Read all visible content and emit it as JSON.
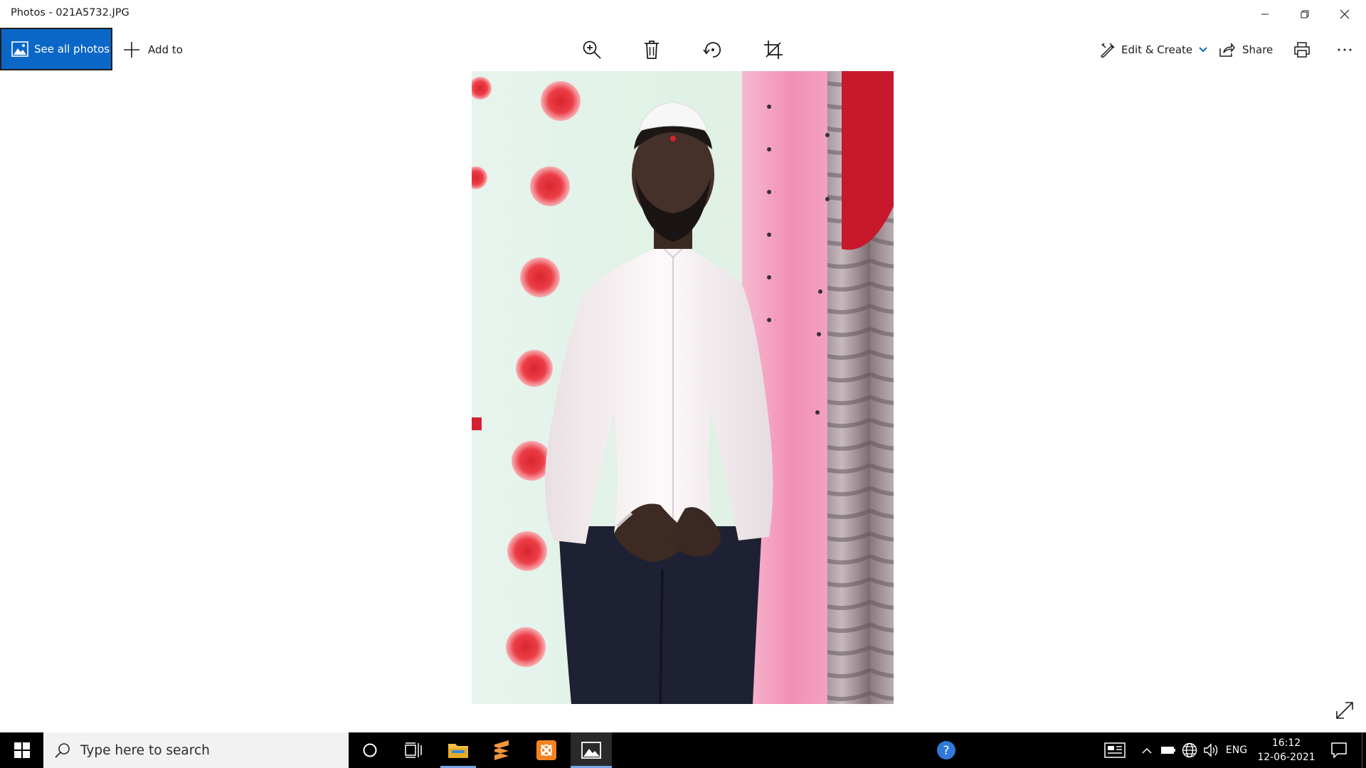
{
  "window": {
    "title": "Photos - 021A5732.JPG",
    "controls": [
      "minimize-icon",
      "restore-icon",
      "close-icon"
    ]
  },
  "toolbar": {
    "see_all_photos": "See all photos",
    "add_to": "Add to",
    "center_icons": [
      "zoom-icon",
      "delete-icon",
      "rotate-icon",
      "crop-icon"
    ],
    "edit_create": "Edit & Create",
    "share": "Share",
    "print_icon": "print-icon",
    "more_icon": "more-icon"
  },
  "taskbar": {
    "search_placeholder": "Type here to search",
    "language": "ENG",
    "time": "16:12",
    "date": "12-06-2021",
    "pinned_apps": [
      "cortana-icon",
      "task-view-icon",
      "file-explorer-icon",
      "sublime-text-icon",
      "xampp-icon",
      "photos-app-icon"
    ]
  },
  "colors": {
    "accent": "#0a67c8",
    "taskbar": "#000000",
    "active_indicator": "#79a6e6"
  }
}
